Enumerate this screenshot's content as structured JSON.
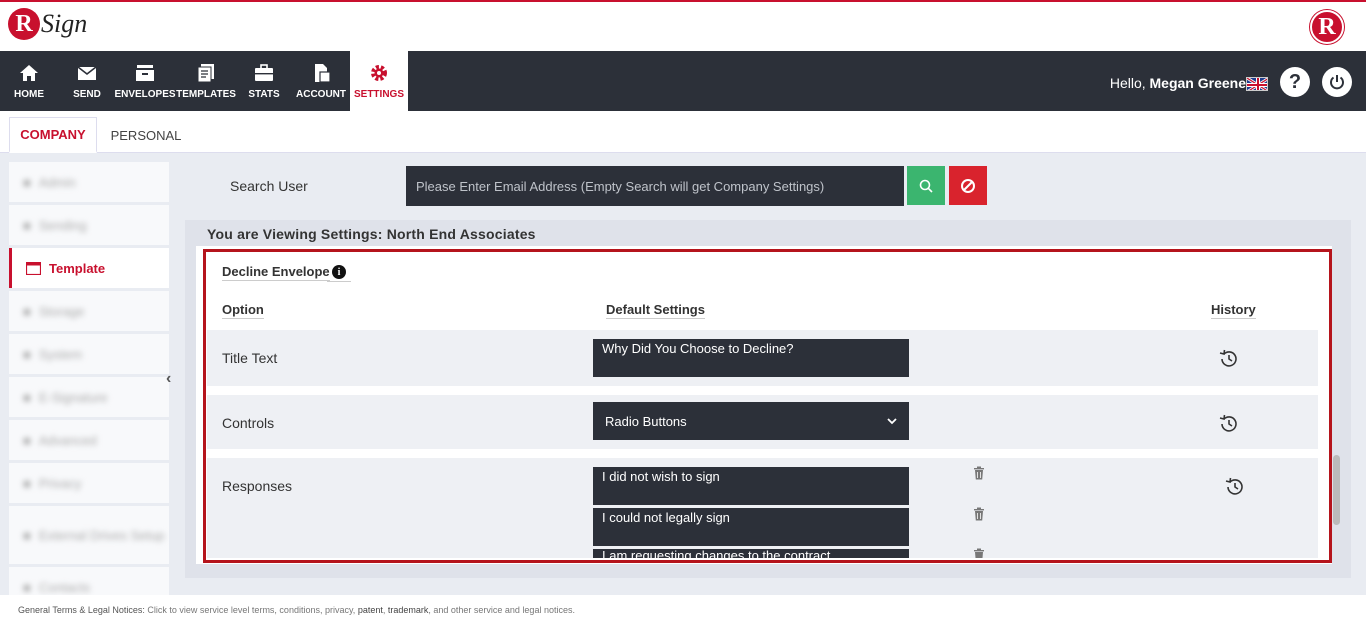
{
  "brand": {
    "logo_letter": "R",
    "logo_text": "Sign",
    "right_logo_letter": "R"
  },
  "nav": {
    "items": [
      {
        "label": "HOME",
        "icon": "home-icon"
      },
      {
        "label": "SEND",
        "icon": "envelope-icon"
      },
      {
        "label": "ENVELOPES",
        "icon": "inbox-icon"
      },
      {
        "label": "TEMPLATES",
        "icon": "templates-icon"
      },
      {
        "label": "STATS",
        "icon": "briefcase-icon"
      },
      {
        "label": "ACCOUNT",
        "icon": "account-icon"
      },
      {
        "label": "SETTINGS",
        "icon": "gear-icon"
      }
    ],
    "active": "SETTINGS",
    "greeting_prefix": "Hello, ",
    "user_name": "Megan Greene",
    "help_label": "?"
  },
  "tabs": {
    "company": "COMPANY",
    "personal": "PERSONAL",
    "active": "COMPANY"
  },
  "sidebar": {
    "items": [
      {
        "label": "Admin",
        "blurred": true
      },
      {
        "label": "Sending",
        "blurred": true
      },
      {
        "label": "Template",
        "blurred": false,
        "active": true
      },
      {
        "label": "Storage",
        "blurred": true
      },
      {
        "label": "System",
        "blurred": true
      },
      {
        "label": "E-Signature",
        "blurred": true
      },
      {
        "label": "Advanced",
        "blurred": true
      },
      {
        "label": "Privacy",
        "blurred": true
      },
      {
        "label": "External Drives Setup",
        "blurred": true
      },
      {
        "label": "Contacts",
        "blurred": true
      }
    ],
    "collapse_glyph": "‹"
  },
  "search": {
    "label": "Search User",
    "placeholder": "Please Enter Email Address (Empty Search will get Company Settings)",
    "value": ""
  },
  "settings": {
    "viewing_text": "You are Viewing Settings: North End Associates",
    "section_title": "Decline Envelope",
    "columns": {
      "option": "Option",
      "default": "Default Settings",
      "history": "History"
    },
    "rows": {
      "title_text": {
        "label": "Title Text",
        "value": "Why Did You Choose to Decline?"
      },
      "controls": {
        "label": "Controls",
        "value": "Radio Buttons"
      },
      "responses": {
        "label": "Responses",
        "values": [
          "I did not wish to sign",
          "I could not legally sign",
          "I am requesting changes to the contract"
        ]
      }
    }
  },
  "footer": {
    "lead": "General Terms & Legal Notices:",
    "text1": " Click to view service level terms, conditions, privacy, ",
    "patent": "patent",
    "sep": ", ",
    "trademark": "trademark",
    "text2": ", and other service and legal notices."
  },
  "colors": {
    "brand_red": "#c8102e",
    "nav_dark": "#2c3039",
    "search_green": "#3bb56f",
    "clear_red": "#d9232d"
  }
}
